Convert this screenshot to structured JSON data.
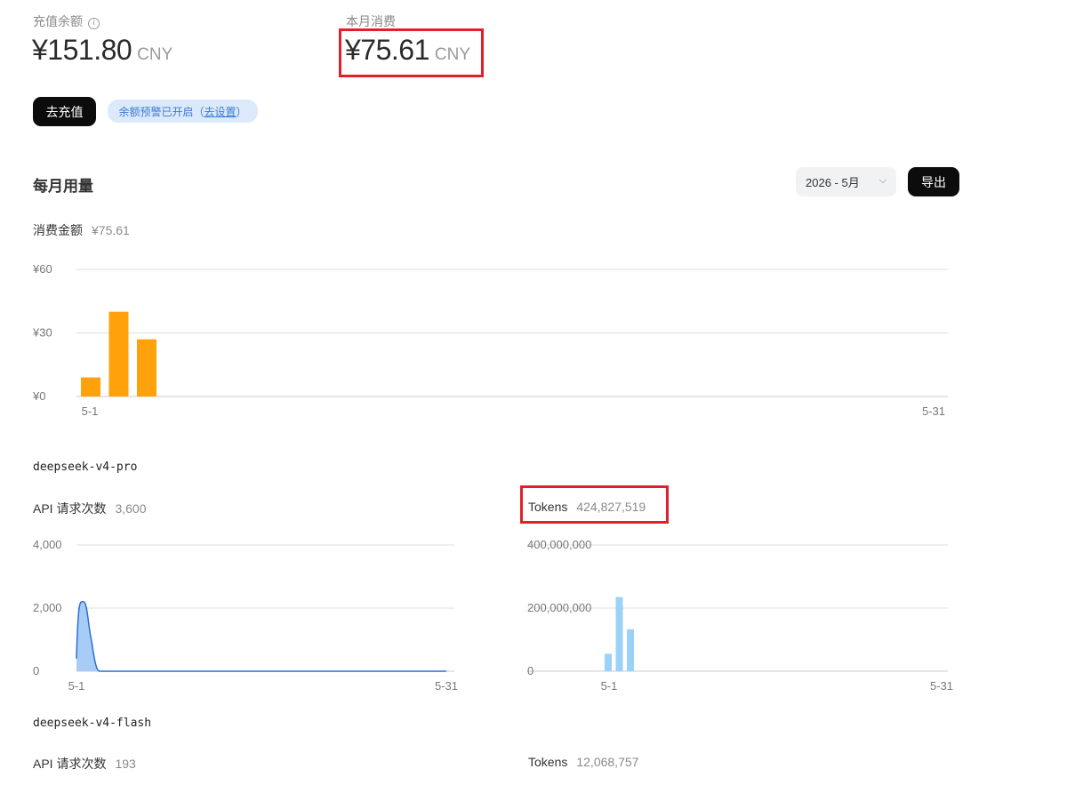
{
  "balance": {
    "label": "充值余额",
    "info_icon": "info-icon",
    "amount": "¥151.80",
    "unit": "CNY"
  },
  "month_spend": {
    "label": "本月消费",
    "amount": "¥75.61",
    "unit": "CNY"
  },
  "recharge_button": "去充值",
  "alert_pill": {
    "text": "余额预警已开启（",
    "link": "去设置",
    "close": "）"
  },
  "usage": {
    "title": "每月用量",
    "month_selector": "2026 - 5月",
    "export_button": "导出"
  },
  "spend_chart": {
    "label": "消费金额",
    "total": "¥75.61"
  },
  "models": [
    {
      "name": "deepseek-v4-pro",
      "requests_label": "API 请求次数",
      "requests": "3,600",
      "tokens_label": "Tokens",
      "tokens": "424,827,519"
    },
    {
      "name": "deepseek-v4-flash",
      "requests_label": "API 请求次数",
      "requests": "193",
      "tokens_label": "Tokens",
      "tokens": "12,068,757"
    }
  ],
  "colors": {
    "spend_bar": "#ffa10a",
    "requests_line": "#2a6fd6",
    "requests_fill": "#a7cdf6",
    "tokens_bar": "#9ad2f8",
    "highlight": "#e0202a",
    "grid": "#dcdcec"
  },
  "chart_data": [
    {
      "type": "bar",
      "title": "消费金额",
      "x_start": "5-1",
      "x_end": "5-31",
      "categories": [
        "5-1",
        "5-2",
        "5-3"
      ],
      "values": [
        9,
        40,
        27
      ],
      "y_ticks": [
        "¥0",
        "¥30",
        "¥60"
      ],
      "ylim": [
        0,
        60
      ],
      "grid": true
    },
    {
      "type": "area",
      "title": "API 请求次数",
      "x_start": "5-1",
      "x_end": "5-31",
      "x": [
        "5-1",
        "5-2",
        "5-3",
        "5-4",
        "5-5"
      ],
      "values": [
        400,
        2200,
        1100,
        0,
        0
      ],
      "y_ticks": [
        "0",
        "2,000",
        "4,000"
      ],
      "ylim": [
        0,
        4000
      ],
      "grid": true
    },
    {
      "type": "bar",
      "title": "Tokens",
      "x_start": "5-1",
      "x_end": "5-31",
      "categories": [
        "5-1",
        "5-2",
        "5-3"
      ],
      "values": [
        55000000,
        235000000,
        133000000
      ],
      "y_ticks": [
        "0",
        "200,000,000",
        "400,000,000"
      ],
      "ylim": [
        0,
        400000000
      ],
      "grid": true
    }
  ]
}
